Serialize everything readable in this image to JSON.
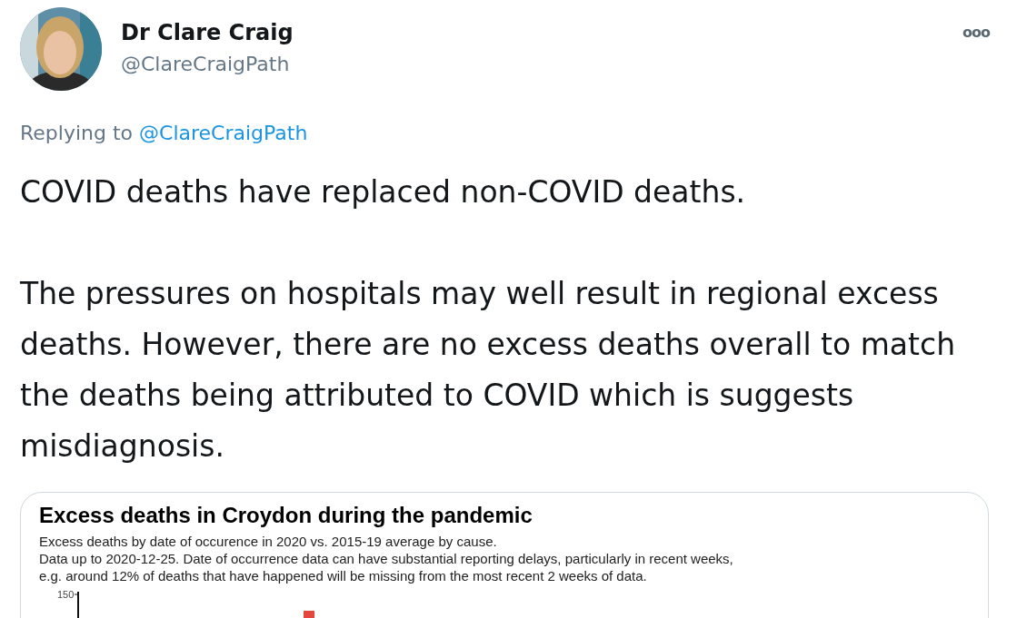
{
  "author": {
    "name": "Dr Clare Craig",
    "handle": "@ClareCraigPath"
  },
  "more_menu": "ooo",
  "reply_context": {
    "prefix": "Replying to",
    "mention": "@ClareCraigPath"
  },
  "paragraphs": [
    "COVID deaths have replaced non-COVID deaths.",
    "The pressures on hospitals may well result in regional excess deaths. However, there are no excess deaths overall to match the deaths being attributed to COVID which is suggests misdiagnosis."
  ],
  "attached_image": {
    "title": "Excess deaths in Croydon during the pandemic",
    "subtitle_lines": [
      "Excess deaths by date of occurence in 2020 vs. 2015-19 average by cause.",
      "Data up to 2020-12-25. Date of occurrence data can have substantial reporting delays, particularly in recent weeks,",
      "e.g. around 12% of deaths that have happened will be missing from the most recent 2 weeks of data."
    ],
    "y_tick": "150"
  }
}
